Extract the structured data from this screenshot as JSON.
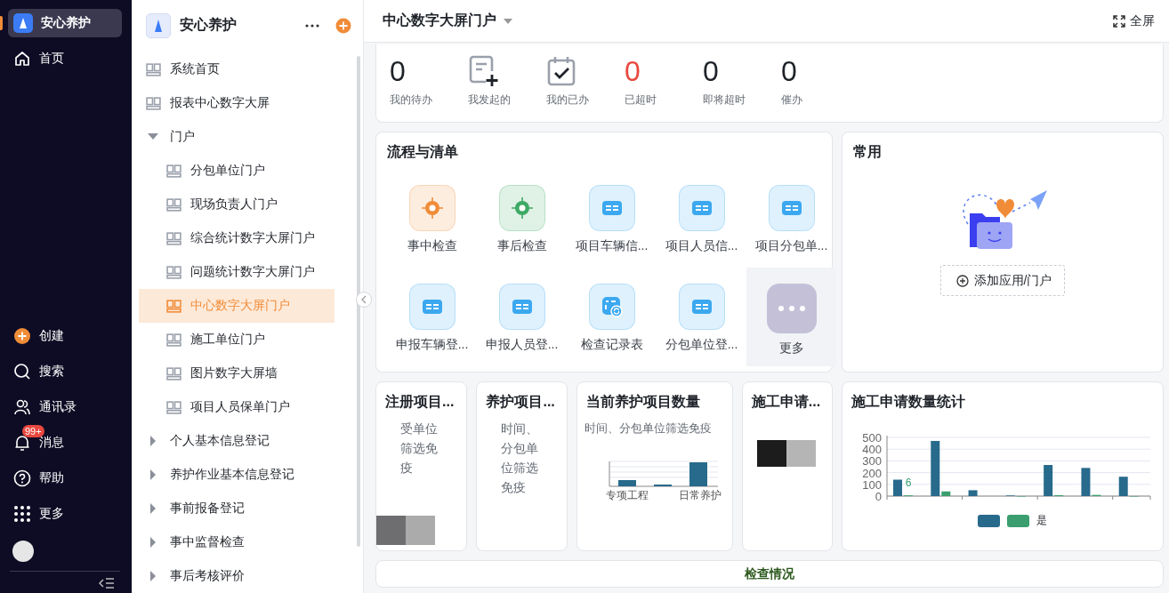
{
  "app_bar": {
    "items": [
      {
        "label": "安心养护",
        "kind": "app",
        "selected": true
      },
      {
        "label": "首页",
        "kind": "home",
        "selected": false
      }
    ],
    "bottom_items": [
      {
        "label": "创建",
        "kind": "create"
      },
      {
        "label": "搜索",
        "kind": "search"
      },
      {
        "label": "通讯录",
        "kind": "contacts"
      },
      {
        "label": "消息",
        "kind": "bell",
        "badge": "99+"
      },
      {
        "label": "帮助",
        "kind": "help"
      },
      {
        "label": "更多",
        "kind": "grid"
      }
    ]
  },
  "nav": {
    "title": "安心养护",
    "items": [
      {
        "label": "系统首页",
        "kind": "page",
        "selected": false
      },
      {
        "label": "报表中心数字大屏",
        "kind": "page",
        "selected": false
      },
      {
        "label": "门户",
        "kind": "folder",
        "selected": false,
        "expanded": true,
        "children": [
          {
            "label": "分包单位门户",
            "kind": "page",
            "selected": false
          },
          {
            "label": "现场负责人门户",
            "kind": "page",
            "selected": false
          },
          {
            "label": "综合统计数字大屏门户",
            "kind": "page",
            "selected": false
          },
          {
            "label": "问题统计数字大屏门户",
            "kind": "page",
            "selected": false
          },
          {
            "label": "中心数字大屏门户",
            "kind": "page",
            "selected": true
          },
          {
            "label": "施工单位门户",
            "kind": "page",
            "selected": false
          },
          {
            "label": "图片数字大屏墙",
            "kind": "page",
            "selected": false
          },
          {
            "label": "项目人员保单门户",
            "kind": "page",
            "selected": false
          }
        ]
      },
      {
        "label": "个人基本信息登记",
        "kind": "folder",
        "selected": false,
        "expanded": false
      },
      {
        "label": "养护作业基本信息登记",
        "kind": "folder",
        "selected": false,
        "expanded": false
      },
      {
        "label": "事前报备登记",
        "kind": "folder",
        "selected": false,
        "expanded": false
      },
      {
        "label": "事中监督检查",
        "kind": "folder",
        "selected": false,
        "expanded": false
      },
      {
        "label": "事后考核评价",
        "kind": "folder",
        "selected": false,
        "expanded": false
      }
    ]
  },
  "header": {
    "title": "中心数字大屏门户",
    "fullscreen": "全屏"
  },
  "stats": [
    {
      "kind": "count",
      "value": "0",
      "label": "我的待办",
      "alert": false
    },
    {
      "kind": "document",
      "label": "我发起的"
    },
    {
      "kind": "calendar",
      "label": "我的已办"
    },
    {
      "kind": "count",
      "value": "0",
      "label": "已超时",
      "alert": true
    },
    {
      "kind": "count",
      "value": "0",
      "label": "即将超时",
      "alert": false
    },
    {
      "kind": "count",
      "value": "0",
      "label": "催办",
      "alert": false
    }
  ],
  "workflows": {
    "title": "流程与清单",
    "apps": [
      {
        "label": "事中检查",
        "kind": "target",
        "color": "#f08c38",
        "highlighted": false
      },
      {
        "label": "事后检查",
        "kind": "target",
        "color": "#3daa64",
        "highlighted": false
      },
      {
        "label": "项目车辆信...",
        "kind": "table",
        "color": "#3ba8f0",
        "highlighted": false
      },
      {
        "label": "项目人员信...",
        "kind": "table",
        "color": "#3ba8f0",
        "highlighted": false
      },
      {
        "label": "项目分包单...",
        "kind": "table",
        "color": "#3ba8f0",
        "highlighted": false
      },
      {
        "label": "申报车辆登...",
        "kind": "table",
        "color": "#3ba8f0",
        "highlighted": false
      },
      {
        "label": "申报人员登...",
        "kind": "table",
        "color": "#3ba8f0",
        "highlighted": false
      },
      {
        "label": "检查记录表",
        "kind": "sync",
        "color": "#3ba8f0",
        "highlighted": false
      },
      {
        "label": "分包单位登...",
        "kind": "table",
        "color": "#3ba8f0",
        "highlighted": false
      },
      {
        "label": "更多",
        "kind": "more",
        "color": "#c3c0d8",
        "highlighted": true
      }
    ]
  },
  "favorites": {
    "title": "常用",
    "add_button": "添加应用/门户"
  },
  "widgets": [
    {
      "kind": "text",
      "title": "注册项目...",
      "text": "受单位筛选免疫",
      "blocks": true
    },
    {
      "kind": "text",
      "title": "养护项目...",
      "text": "时间、分包单位筛选免疫",
      "blocks": false
    },
    {
      "kind": "mini_chart",
      "title": "当前养护项目数量",
      "text": "时间、分包单位筛选免疫",
      "axis_labels": [
        "专项工程",
        "日常养护"
      ]
    },
    {
      "kind": "blocks",
      "title": "施工申请..."
    },
    {
      "kind": "chart",
      "title": "施工申请数量统计",
      "chart_data": {
        "type": "bar",
        "ylim": [
          0,
          500
        ],
        "yticks": [
          0,
          100,
          200,
          300,
          400,
          500
        ],
        "series": [
          {
            "color": "#286a8c",
            "values": [
              140,
              470,
              50,
              5,
              265,
              240,
              165
            ]
          },
          {
            "name": "是",
            "color": "#3a9e6e",
            "values": [
              6,
              40,
              null,
              0,
              8,
              10,
              0
            ]
          }
        ],
        "grid": true
      },
      "data_label": "6"
    }
  ],
  "footer": {
    "title": "检查情况"
  }
}
